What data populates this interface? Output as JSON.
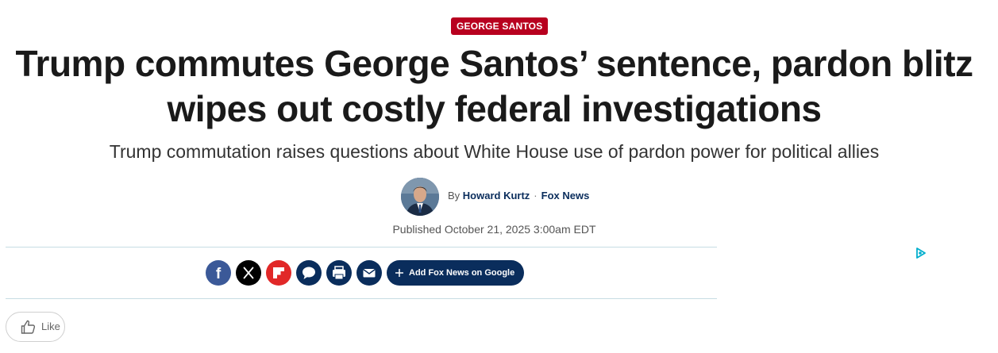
{
  "article": {
    "tag": "GEORGE SANTOS",
    "headline_line1": "Trump commutes George Santos’ sentence, pardon blitz",
    "headline_line2": "wipes out costly federal investigations",
    "subhead": "Trump commutation raises questions about White House use of pardon power for political allies",
    "byline_prefix": "By",
    "author": "Howard Kurtz",
    "outlet": "Fox News",
    "published": "Published October 21, 2025 3:00am EDT"
  },
  "share": {
    "icons": [
      "facebook-icon",
      "x-icon",
      "flipboard-icon",
      "comments-icon",
      "print-icon",
      "email-icon"
    ],
    "google_label": "Add Fox News on Google"
  },
  "like": {
    "label": "Like"
  },
  "colors": {
    "tag_red": "#b8001f",
    "navy": "#0a2d5c",
    "facebook": "#3b5998",
    "x": "#000000",
    "flipboard": "#e12828",
    "rule": "#c7dde3",
    "adchoice": "#00aecd"
  }
}
